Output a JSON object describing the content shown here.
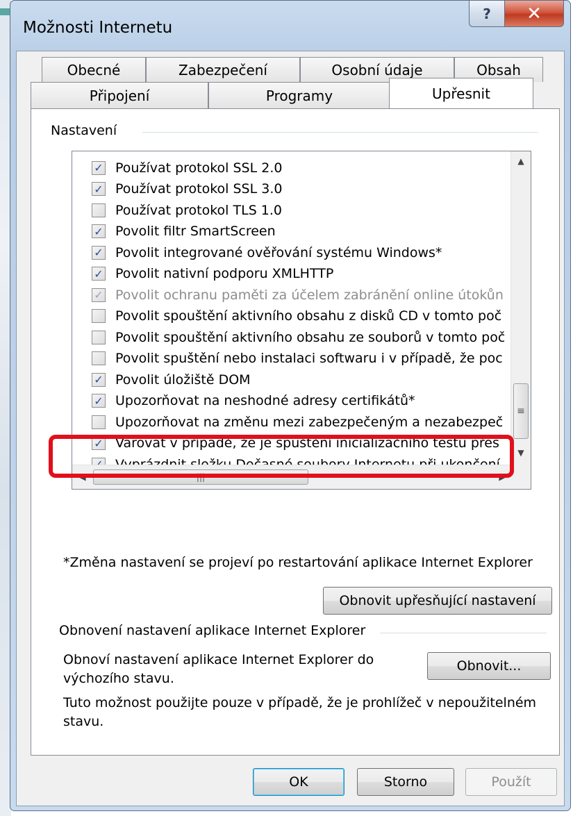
{
  "window": {
    "title": "Možnosti Internetu",
    "help_label": "?",
    "close_label": "✕"
  },
  "tabs_top": [
    {
      "label": "Obecné"
    },
    {
      "label": "Zabezpečení"
    },
    {
      "label": "Osobní údaje"
    },
    {
      "label": "Obsah"
    }
  ],
  "tabs_bottom": [
    {
      "label": "Připojení"
    },
    {
      "label": "Programy"
    },
    {
      "label": "Upřesnit"
    }
  ],
  "settings": {
    "group_label": "Nastavení",
    "items": [
      {
        "label": "Používat protokol SSL 2.0",
        "checked": true
      },
      {
        "label": "Používat protokol SSL 3.0",
        "checked": true
      },
      {
        "label": "Používat protokol TLS 1.0",
        "checked": false
      },
      {
        "label": "Povolit filtr SmartScreen",
        "checked": true
      },
      {
        "label": "Povolit integrované ověřování systému Windows*",
        "checked": true
      },
      {
        "label": "Povolit nativní podporu XMLHTTP",
        "checked": true
      },
      {
        "label": "Povolit ochranu paměti za účelem zabránění online útokůn",
        "checked": true,
        "disabled": true
      },
      {
        "label": "Povolit spouštění aktivního obsahu z disků CD v tomto poč",
        "checked": false
      },
      {
        "label": "Povolit spouštění aktivního obsahu ze souborů v tomto poč",
        "checked": false
      },
      {
        "label": "Povolit spuštění nebo instalaci softwaru i v případě, že poc",
        "checked": false
      },
      {
        "label": "Povolit úložiště DOM",
        "checked": true
      },
      {
        "label": "Upozorňovat na neshodné adresy certifikátů*",
        "checked": true
      },
      {
        "label": "Upozorňovat na změnu mezi zabezpečeným a nezabezpeč",
        "checked": false
      },
      {
        "label": "Varovat v případě, že je spuštění inicializačního testu přes",
        "checked": true
      },
      {
        "label": "Vyprázdnit složku Dočasné soubory Internetu při ukončení",
        "checked": true
      }
    ],
    "note": "*Změna nastavení se projeví po restartování aplikace Internet Explorer",
    "restore_advanced_label": "Obnovit upřesňující nastavení"
  },
  "reset": {
    "group_label": "Obnovení nastavení aplikace Internet Explorer",
    "description": "Obnoví nastavení aplikace Internet Explorer do výchozího stavu.",
    "button_label": "Obnovit...",
    "warning": "Tuto možnost použijte pouze v případě, že je prohlížeč v nepoužitelném stavu."
  },
  "footer": {
    "ok_label": "OK",
    "cancel_label": "Storno",
    "apply_label": "Použít"
  },
  "icons": {
    "checkmark": "✓",
    "scroll_up": "▲",
    "scroll_down": "▼",
    "scroll_left": "◀",
    "scroll_right": "▶",
    "grip": "≡"
  },
  "colors": {
    "highlight": "#e0101c",
    "checkmark": "#2b4f9e"
  }
}
